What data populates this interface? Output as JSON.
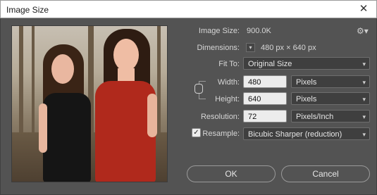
{
  "window": {
    "title": "Image Size",
    "close_glyph": "✕"
  },
  "image_size": {
    "label": "Image Size:",
    "value": "900.0K"
  },
  "settings_icon": "gear-icon",
  "dimensions": {
    "label": "Dimensions:",
    "value": "480 px  ×  640 px"
  },
  "fit_to": {
    "label": "Fit To:",
    "value": "Original Size"
  },
  "width": {
    "label": "Width:",
    "value": "480",
    "unit": "Pixels"
  },
  "height": {
    "label": "Height:",
    "value": "640",
    "unit": "Pixels"
  },
  "resolution": {
    "label": "Resolution:",
    "value": "72",
    "unit": "Pixels/Inch"
  },
  "resample": {
    "label": "Resample:",
    "checked": true,
    "value": "Bicubic Sharper (reduction)"
  },
  "buttons": {
    "ok": "OK",
    "cancel": "Cancel"
  }
}
